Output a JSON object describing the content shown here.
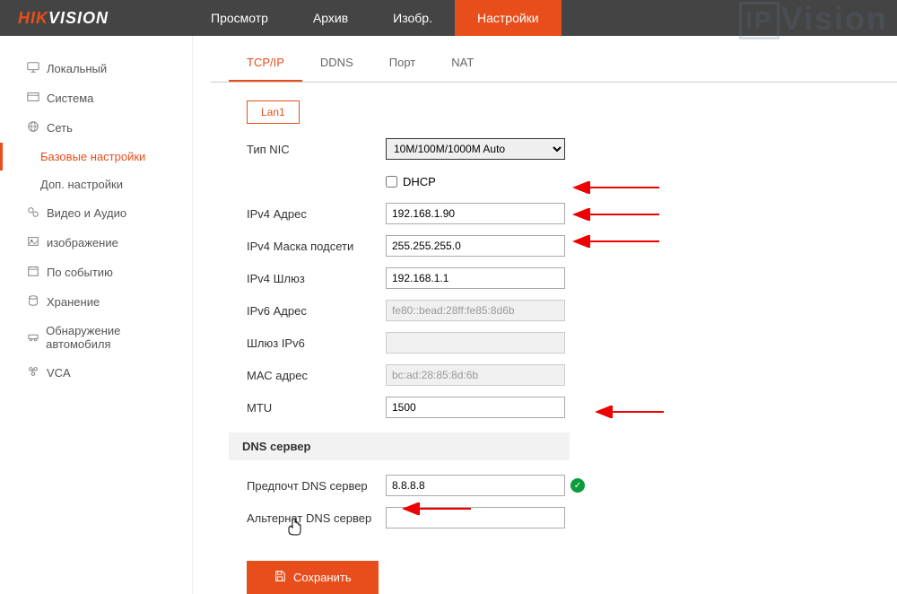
{
  "logo": {
    "prefix": "HIK",
    "suffix": "VISION"
  },
  "topMenu": [
    {
      "label": "Просмотр",
      "active": false
    },
    {
      "label": "Архив",
      "active": false
    },
    {
      "label": "Изобр.",
      "active": false
    },
    {
      "label": "Настройки",
      "active": true
    }
  ],
  "sidebar": {
    "items": [
      {
        "label": "Локальный",
        "type": "main"
      },
      {
        "label": "Система",
        "type": "main"
      },
      {
        "label": "Сеть",
        "type": "main"
      },
      {
        "label": "Базовые настройки",
        "type": "sub",
        "active": true
      },
      {
        "label": "Доп. настройки",
        "type": "sub"
      },
      {
        "label": "Видео и Аудио",
        "type": "main"
      },
      {
        "label": "изображение",
        "type": "main"
      },
      {
        "label": "По событию",
        "type": "main"
      },
      {
        "label": "Хранение",
        "type": "main"
      },
      {
        "label": "Обнаружение автомобиля",
        "type": "main"
      },
      {
        "label": "VCA",
        "type": "main"
      }
    ]
  },
  "tabs": [
    {
      "label": "TCP/IP",
      "active": true
    },
    {
      "label": "DDNS"
    },
    {
      "label": "Порт"
    },
    {
      "label": "NAT"
    }
  ],
  "lanTab": "Lan1",
  "form": {
    "nicType": {
      "label": "Тип NIC",
      "value": "10M/100M/1000M Auto"
    },
    "dhcp": {
      "label": "DHCP",
      "checked": false
    },
    "ipv4Address": {
      "label": "IPv4 Адрес",
      "value": "192.168.1.90"
    },
    "ipv4Mask": {
      "label": "IPv4 Маска подсети",
      "value": "255.255.255.0"
    },
    "ipv4Gateway": {
      "label": "IPv4 Шлюз",
      "value": "192.168.1.1"
    },
    "ipv6Address": {
      "label": "IPv6 Адрес",
      "value": "fe80::bead:28ff:fe85:8d6b"
    },
    "ipv6Gateway": {
      "label": "Шлюз IPv6",
      "value": ""
    },
    "macAddress": {
      "label": "МАС адрес",
      "value": "bc:ad:28:85:8d:6b"
    },
    "mtu": {
      "label": "MTU",
      "value": "1500"
    },
    "dnsSection": "DNS сервер",
    "preferredDns": {
      "label": "Предпочт DNS сервер",
      "value": "8.8.8.8"
    },
    "altDns": {
      "label": "Альтернат DNS сервер",
      "value": ""
    }
  },
  "saveButton": "Сохранить",
  "watermark": {
    "ip": "IP",
    "vision": "Vision"
  }
}
